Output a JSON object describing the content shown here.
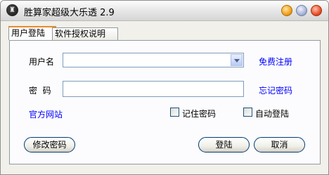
{
  "window": {
    "title": "胜算家超级大乐透 2.9",
    "app_icon_glyph": "♜"
  },
  "tabs": [
    {
      "label": "用户登陆",
      "active": true
    },
    {
      "label": "软件授权说明",
      "active": false
    }
  ],
  "login": {
    "username_label": "用户名",
    "username_value": "",
    "register_link": "免费注册",
    "password_label": "密  码",
    "password_value": "",
    "forgot_link": "忘记密码",
    "website_link": "官方网站",
    "remember_label": "记住密码",
    "remember_checked": false,
    "autologin_label": "自动登陆",
    "autologin_checked": false
  },
  "buttons": {
    "change_password": "修改密码",
    "login": "登陆",
    "cancel": "取消"
  },
  "colors": {
    "link": "#0000ff",
    "tab_accent": "#e68b2c",
    "button_border": "#003c74"
  }
}
